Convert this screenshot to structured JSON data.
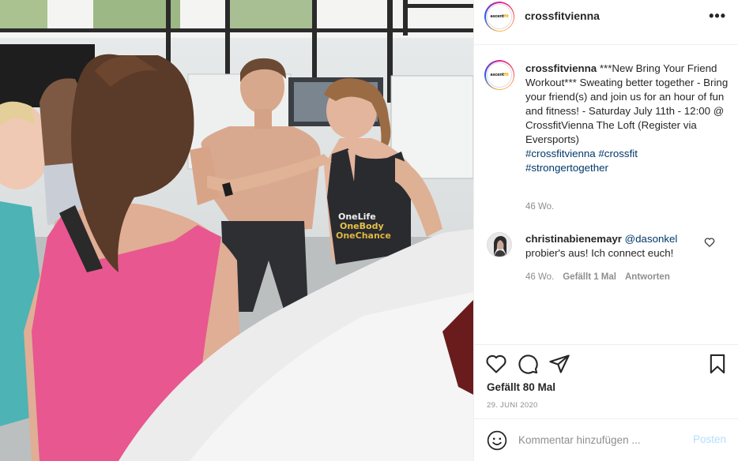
{
  "post": {
    "username": "crossfitvienna",
    "logo_prefix": "ascent",
    "logo_suffix": "fit",
    "more_icon": "more-horizontal-icon"
  },
  "caption": {
    "username": "crossfitvienna",
    "text": " ***New Bring Your Friend Workout*** Sweating better together - Bring your friend(s) and join us for an hour of fun and fitness! - Saturday July 11th - 12:00 @ CrossfitVienna The Loft (Register via Eversports)",
    "hashtags": [
      "#crossfitvienna",
      "#crossfit",
      "#strongertogether"
    ],
    "time": "46 Wo."
  },
  "comment": {
    "username": "christinabienemayr",
    "mention": "@dasonkel",
    "text": "probier's aus! Ich connect euch!",
    "time": "46 Wo.",
    "likes": "Gefällt 1 Mal",
    "reply": "Antworten"
  },
  "actions": {
    "likes_text": "Gefällt 80 Mal",
    "date": "29. JUNI 2020",
    "icons": [
      "heart-icon",
      "comment-icon",
      "share-icon",
      "bookmark-icon"
    ]
  },
  "add_comment": {
    "placeholder": "Kommentar hinzufügen ...",
    "post_label": "Posten",
    "post_color": "#b2dffc"
  },
  "photo": {
    "shirt_lines": [
      "OneLife",
      "OneBody",
      "OneChance"
    ]
  }
}
